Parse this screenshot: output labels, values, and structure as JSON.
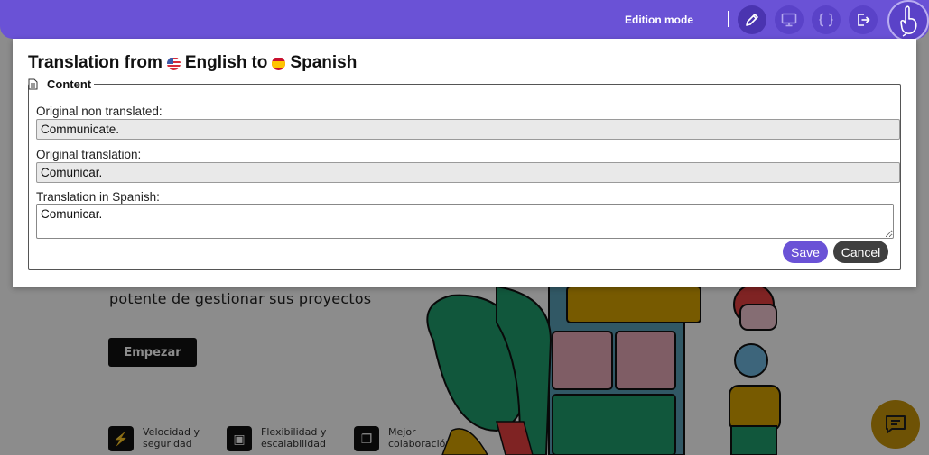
{
  "toolbar": {
    "mode_label": "Edition mode",
    "buttons": [
      {
        "icon": "pencil-icon"
      },
      {
        "icon": "monitor-icon"
      },
      {
        "icon": "code-braces-icon"
      },
      {
        "icon": "logout-icon"
      }
    ],
    "brand_icon": "pointer-hand-icon",
    "color": "#6a52d6"
  },
  "modal": {
    "title_prefix": "Translation from",
    "source_language": "English",
    "title_middle": "to",
    "target_language": "Spanish",
    "fieldset_legend": "Content",
    "fields": {
      "original_label": "Original non translated:",
      "original_value": "Communicate.",
      "original_translation_label": "Original translation:",
      "original_translation_value": "Comunicar.",
      "translation_label": "Translation in Spanish:",
      "translation_value": "Comunicar."
    },
    "save_label": "Save",
    "cancel_label": "Cancel"
  },
  "background": {
    "hero_text": "potente de gestionar sus proyectos",
    "cta_label": "Empezar",
    "features": [
      {
        "label": "Velocidad y\nseguridad",
        "icon": "bolt-icon"
      },
      {
        "label": "Flexibilidad y\nescalabilidad",
        "icon": "expand-icon"
      },
      {
        "label": "Mejor\ncolaboración",
        "icon": "layers-icon"
      }
    ],
    "chat_icon": "chat-icon"
  }
}
